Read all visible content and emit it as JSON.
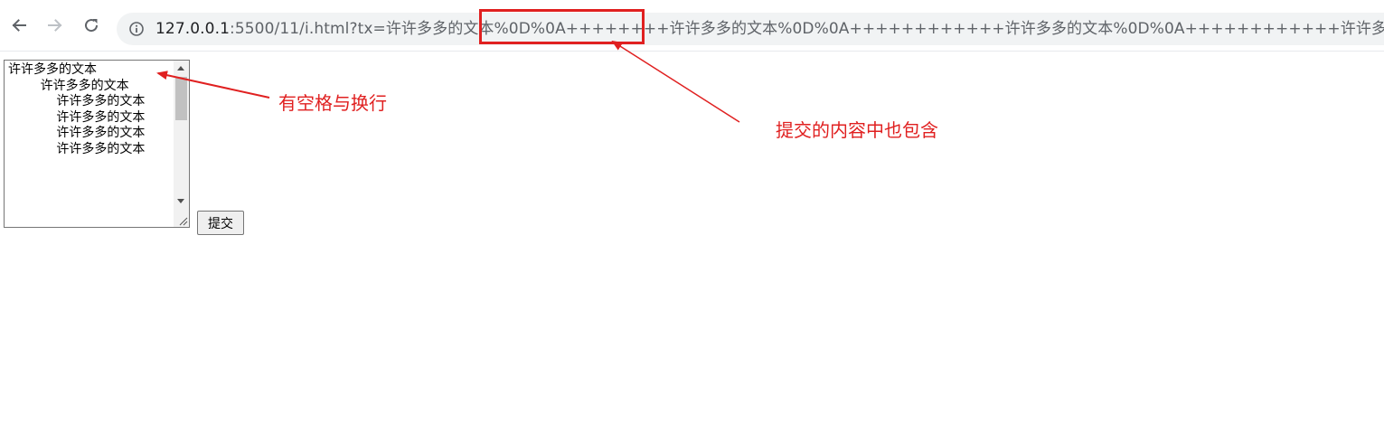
{
  "browser": {
    "url_host": "127.0.0.1",
    "url_rest": ":5500/11/i.html?tx=许许多多的文本%0D%0A++++++++许许多多的文本%0D%0A++++++++++++许许多多的文本%0D%0A++++++++++++许许多多的文本"
  },
  "form": {
    "textarea_value": "许许多多的文本\n        许许多多的文本\n            许许多多的文本\n            许许多多的文本\n            许许多多的文本\n            许许多多的文本",
    "submit_label": "提交"
  },
  "annotations": {
    "spaces_newlines": "有空格与换行",
    "submitted_contains": "提交的内容中也包含",
    "color": "#e02020"
  },
  "icons": {
    "back": "back-arrow-icon",
    "forward": "forward-arrow-icon",
    "reload": "reload-icon",
    "site_info": "info-icon"
  }
}
